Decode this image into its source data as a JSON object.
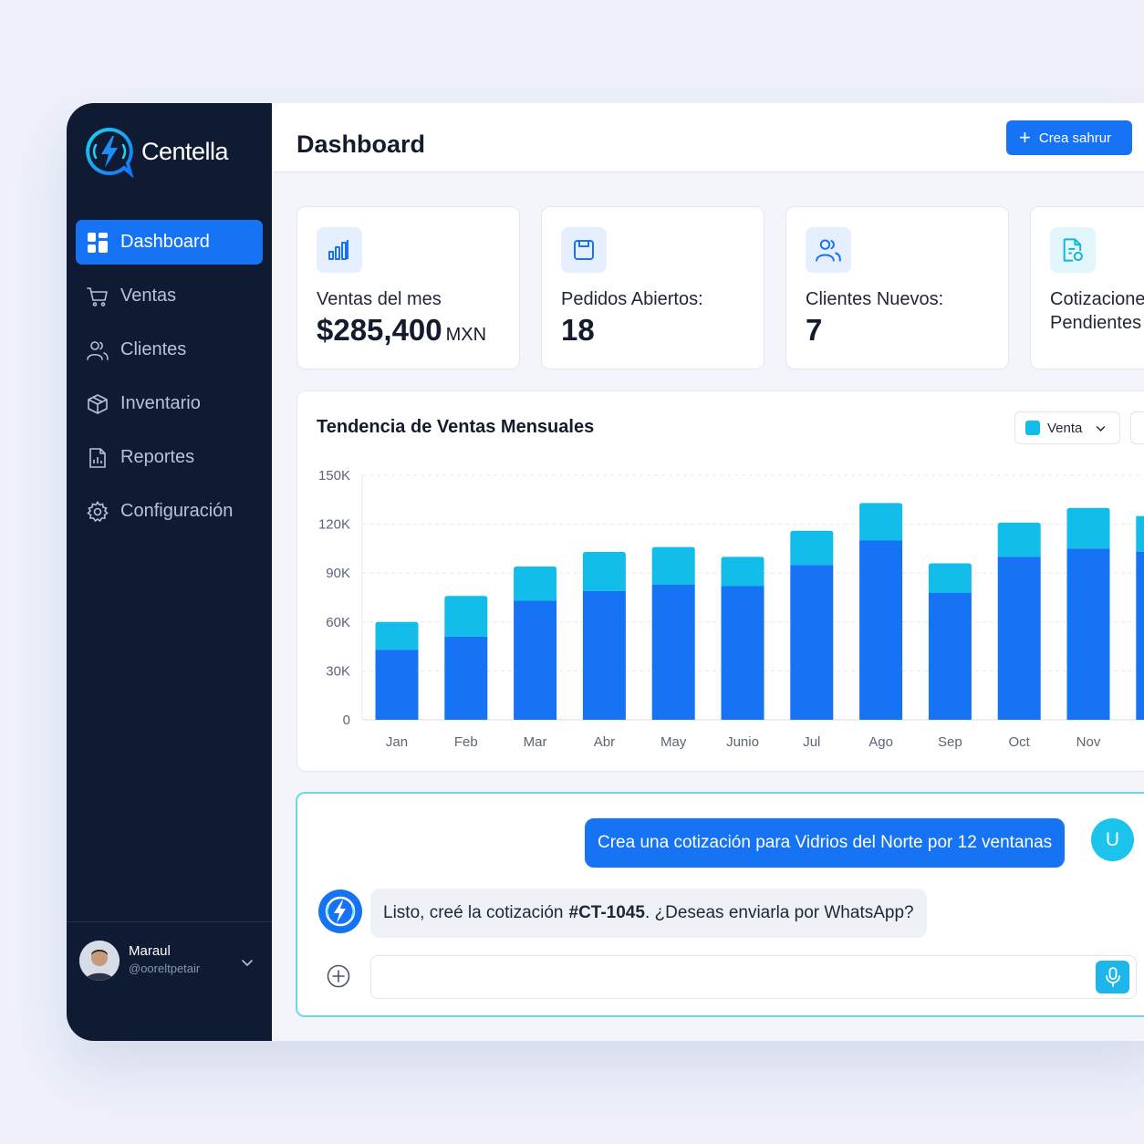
{
  "brand": {
    "name": "Centella",
    "logo": "lightning-chat-logo"
  },
  "sidebar": {
    "items": [
      {
        "label": "Dashboard",
        "icon": "dashboard-grid-icon",
        "active": true
      },
      {
        "label": "Ventas",
        "icon": "shopping-cart-icon"
      },
      {
        "label": "Clientes",
        "icon": "users-icon"
      },
      {
        "label": "Inventario",
        "icon": "box-icon"
      },
      {
        "label": "Reportes",
        "icon": "report-icon"
      },
      {
        "label": "Configuración",
        "icon": "gear-icon"
      }
    ]
  },
  "user": {
    "name": "Maraul",
    "handle": "@ooreltpetair"
  },
  "header": {
    "title": "Dashboard",
    "primary_button": "Crea sahrur"
  },
  "kpis": [
    {
      "label": "Ventas del mes",
      "value": "$285,400",
      "unit": "MXN",
      "icon": "bar-chart-icon"
    },
    {
      "label": "Pedidos Abiertos:",
      "value": "18",
      "icon": "save-icon"
    },
    {
      "label": "Clientes Nuevos:",
      "value": "7",
      "icon": "users-icon"
    },
    {
      "label": "Cotizaciones",
      "label_line2": "Pendientes",
      "icon": "document-icon"
    }
  ],
  "chart_title": "Tendencia de Ventas Mensuales",
  "legend_select": "Venta",
  "colors": {
    "accent": "#1673f3",
    "cyan": "#1cc3ea",
    "sidebar": "#0f1a33"
  },
  "chart_data": {
    "type": "bar",
    "stacked": true,
    "title": "Tendencia de Ventas Mensuales",
    "categories": [
      "Jan",
      "Feb",
      "Mar",
      "Abr",
      "May",
      "Junio",
      "Jul",
      "Ago",
      "Sep",
      "Oct",
      "Nov"
    ],
    "series": [
      {
        "name": "Venta",
        "values": [
          43000,
          51000,
          73000,
          79000,
          83000,
          82000,
          95000,
          110000,
          78000,
          100000,
          105000
        ]
      },
      {
        "values": [
          17000,
          25000,
          21000,
          24000,
          23000,
          18000,
          21000,
          23000,
          18000,
          21000,
          25000
        ]
      }
    ],
    "yticks": [
      "0",
      "30K",
      "60K",
      "90K",
      "120K",
      "150K"
    ],
    "ylim": [
      0,
      150000
    ],
    "grid": true,
    "legend": "top-right"
  },
  "chat": {
    "user_message": "Crea una cotización para Vidrios del Norte por 12 ventanas",
    "user_badge": "U",
    "bot_message_pre": "Listo, creé la cotización",
    "bot_message_code": "#CT-1045",
    "bot_message_post": ". ¿Deseas enviarla por WhatsApp?",
    "input_placeholder": ""
  }
}
